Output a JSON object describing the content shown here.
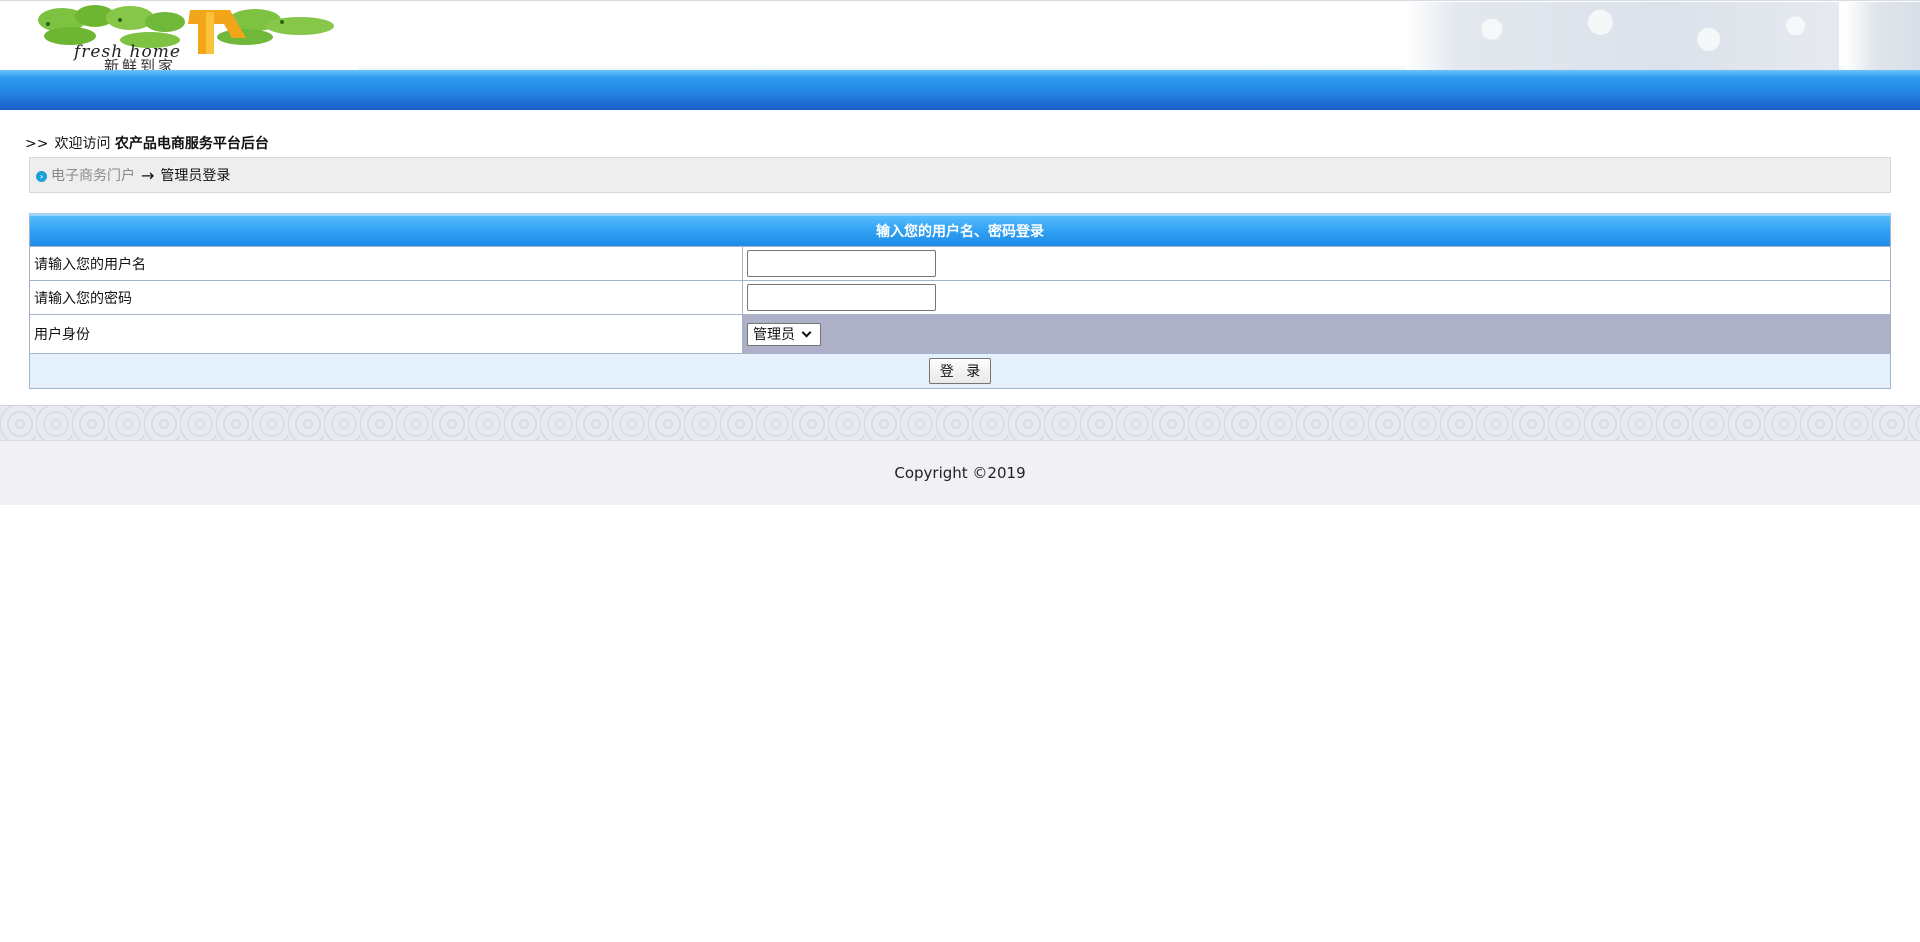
{
  "header": {
    "logo_caption": "新鲜到家",
    "logo_script": "fresh home"
  },
  "welcome": {
    "arrows": ">>",
    "prefix": "欢迎访问",
    "site_name": "农产品电商服务平台后台"
  },
  "breadcrumb": {
    "home_link": "电子商务门户",
    "separator": "→",
    "current": "管理员登录"
  },
  "login": {
    "title": "输入您的用户名、密码登录",
    "username_label": "请输入您的用户名",
    "username_value": "",
    "password_label": "请输入您的密码",
    "password_value": "",
    "role_label": "用户身份",
    "role_selected": "管理员",
    "submit_label": "登 录"
  },
  "footer": {
    "copyright": "Copyright ©2019"
  },
  "colors": {
    "blue_bar": "#2489e6",
    "table_header": "#2d9ef2",
    "role_cell_bg": "#adb0c6",
    "submit_row_bg": "#e4f1fc",
    "breadcrumb_bg": "#eeeeee",
    "footer_bg": "#f0f0f5"
  }
}
